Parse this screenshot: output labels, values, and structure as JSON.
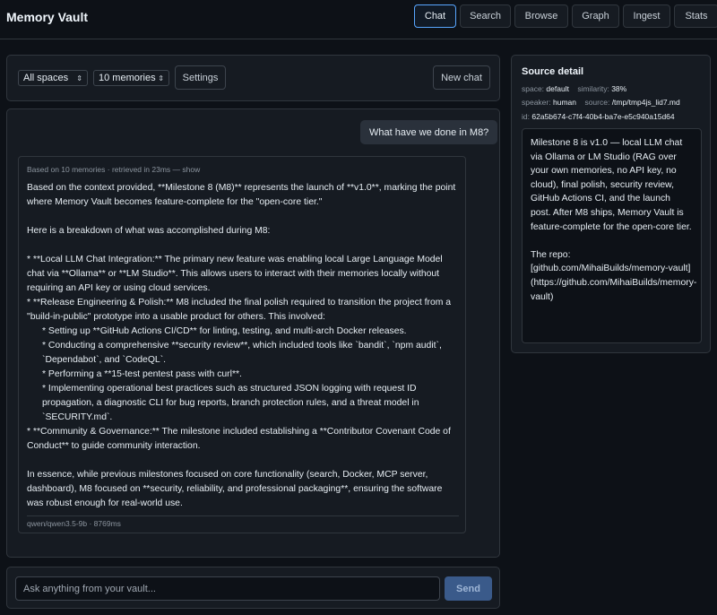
{
  "app": {
    "title": "Memory Vault"
  },
  "nav": {
    "tabs": [
      {
        "label": "Chat",
        "active": true
      },
      {
        "label": "Search",
        "active": false
      },
      {
        "label": "Browse",
        "active": false
      },
      {
        "label": "Graph",
        "active": false
      },
      {
        "label": "Ingest",
        "active": false
      },
      {
        "label": "Stats",
        "active": false
      }
    ]
  },
  "toolbar": {
    "spaces_select": "All spaces",
    "memories_select": "10 memories",
    "settings_label": "Settings",
    "new_chat_label": "New chat"
  },
  "chat": {
    "user_message": "What have we done in M8?",
    "answer_meta": "Based on 10 memories · retrieved in 23ms — show",
    "answer_lines": {
      "p1": "Based on the context provided, **Milestone 8 (M8)** represents the launch of **v1.0**, marking the point where Memory Vault becomes feature-complete for the \"open-core tier.\"",
      "p2": "Here is a breakdown of what was accomplished during M8:",
      "b1": "*   **Local LLM Chat Integration:** The primary new feature was enabling local Large Language Model chat via **Ollama** or **LM Studio**. This allows users to interact with their memories locally without requiring an API key or using cloud services.",
      "b2": "*   **Release Engineering & Polish:** M8 included the final polish required to transition the project from a \"build-in-public\" prototype into a usable product for others. This involved:",
      "b2a": "*   Setting up **GitHub Actions CI/CD** for linting, testing, and multi-arch Docker releases.",
      "b2b": "*   Conducting a comprehensive **security review**, which included tools like `bandit`, `npm audit`, `Dependabot`, and `CodeQL`.",
      "b2c": "*   Performing a **15-test pentest pass with curl**.",
      "b2d": "*   Implementing operational best practices such as structured JSON logging with request ID propagation, a diagnostic CLI for bug reports, branch protection rules, and a threat model in `SECURITY.md`.",
      "b3": "*   **Community & Governance:** The milestone included establishing a **Contributor Covenant Code of Conduct** to guide community interaction.",
      "p3": "In essence, while previous milestones focused on core functionality (search, Docker, MCP server, dashboard), M8 focused on **security, reliability, and professional packaging**, ensuring the software was robust enough for real-world use."
    },
    "answer_footer": "qwen/qwen3.5-9b · 8769ms",
    "input_placeholder": "Ask anything from your vault...",
    "send_label": "Send"
  },
  "source": {
    "title": "Source detail",
    "space_label": "space:",
    "space_value": "default",
    "similarity_label": "similarity:",
    "similarity_value": "38%",
    "speaker_label": "speaker:",
    "speaker_value": "human",
    "source_label": "source:",
    "source_value": "/tmp/tmp4js_lid7.md",
    "id_label": "id:",
    "id_value": "62a5b674-c7f4-40b4-ba7e-e5c940a15d64",
    "content_p1": "Milestone 8 is v1.0 — local LLM chat via Ollama or LM Studio (RAG over your own memories, no API key, no cloud), final polish, security review, GitHub Actions CI, and the launch post. After M8 ships, Memory Vault is feature-complete for the open-core tier.",
    "content_p2": "The repo: [github.com/MihaiBuilds/memory-vault](https://github.com/MihaiBuilds/memory-vault)"
  }
}
